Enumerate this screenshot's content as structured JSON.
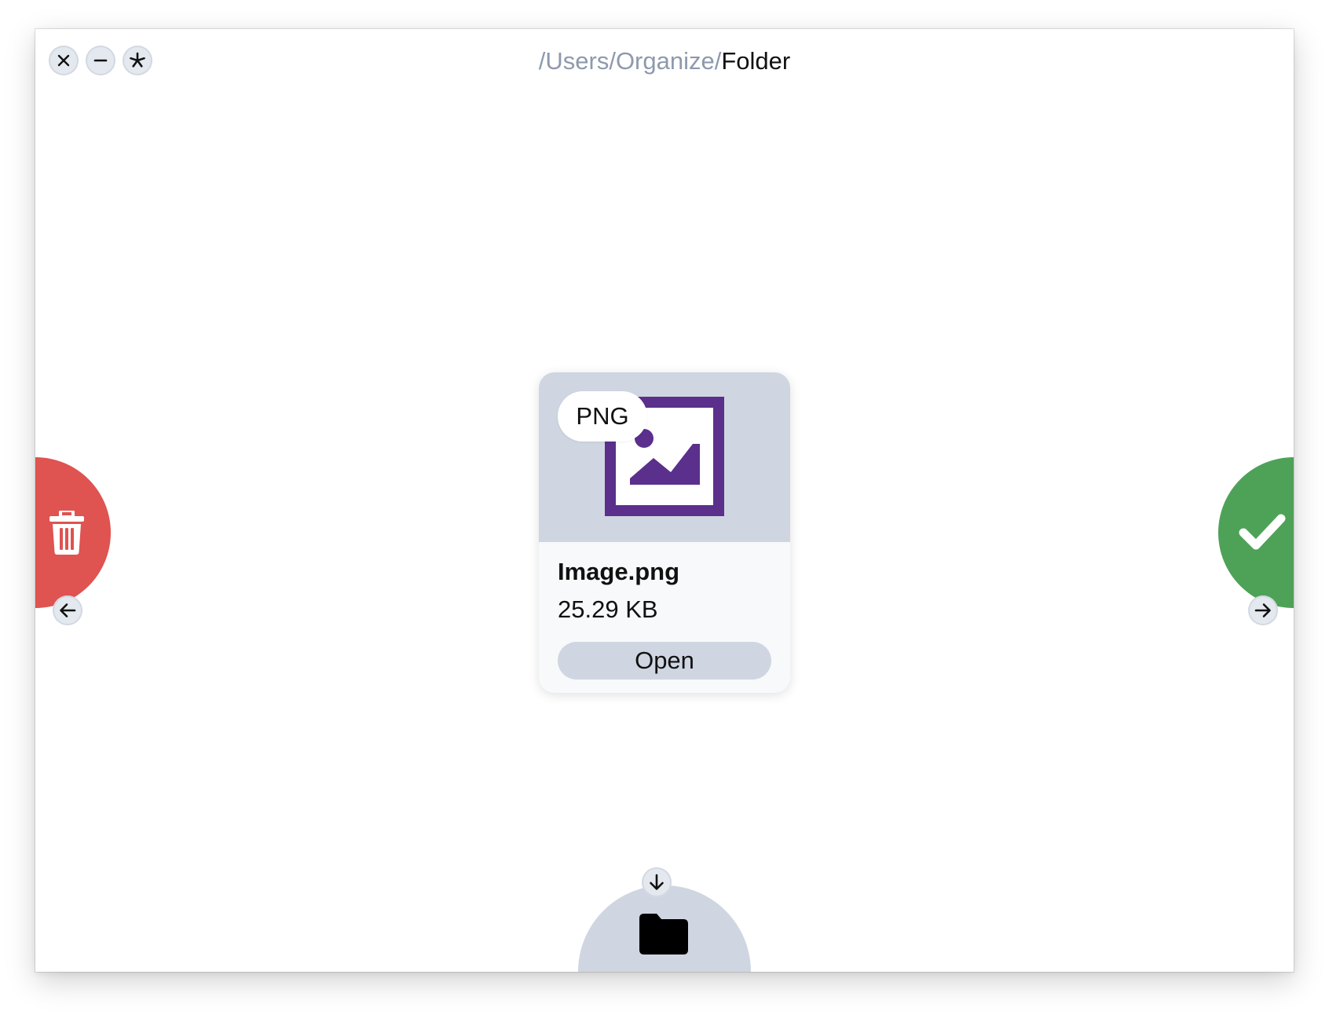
{
  "window": {
    "controls": [
      {
        "name": "close-button",
        "icon": "close-icon"
      },
      {
        "name": "minimize-button",
        "icon": "minus-icon"
      },
      {
        "name": "settings-button",
        "icon": "asterisk-icon"
      }
    ]
  },
  "breadcrumb": {
    "path": "/Users/Organize/",
    "current": "Folder"
  },
  "file": {
    "type_badge": "PNG",
    "name": "Image.png",
    "size": "25.29 KB",
    "open_label": "Open",
    "thumbnail_icon": "image-icon"
  },
  "actions": {
    "delete": {
      "icon": "trash-icon",
      "arrow": "arrow-left-icon",
      "color": "#df5350"
    },
    "keep": {
      "icon": "checkmark-icon",
      "arrow": "arrow-right-icon",
      "color": "#4da257"
    },
    "move": {
      "icon": "folder-icon",
      "arrow": "arrow-down-icon",
      "color": "#cfd6e1"
    }
  },
  "colors": {
    "thumbnail_purple": "#5b2f8c",
    "preview_bg": "#cfd6e1",
    "path_gray": "#8e99ad"
  }
}
